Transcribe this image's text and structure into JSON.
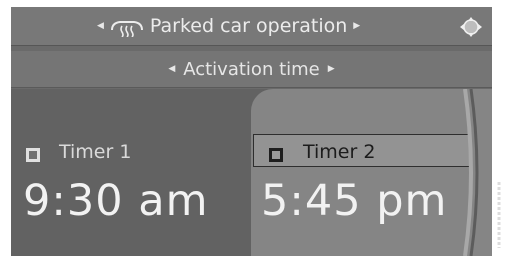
{
  "header": {
    "title": "Parked car operation",
    "icon": "parked-car-heater-icon",
    "nav_arrows": "◂ ▸",
    "controller_icon": "controller-direction-icon"
  },
  "subheader": {
    "title": "Activation time"
  },
  "timers": [
    {
      "label": "Timer 1",
      "time": "9:30 am",
      "selected": false
    },
    {
      "label": "Timer 2",
      "time": "5:45 pm",
      "selected": true
    }
  ],
  "colors": {
    "screen_bg": "#6a6a6a",
    "highlight_panel": "#858585",
    "text": "#f2f2f2"
  }
}
